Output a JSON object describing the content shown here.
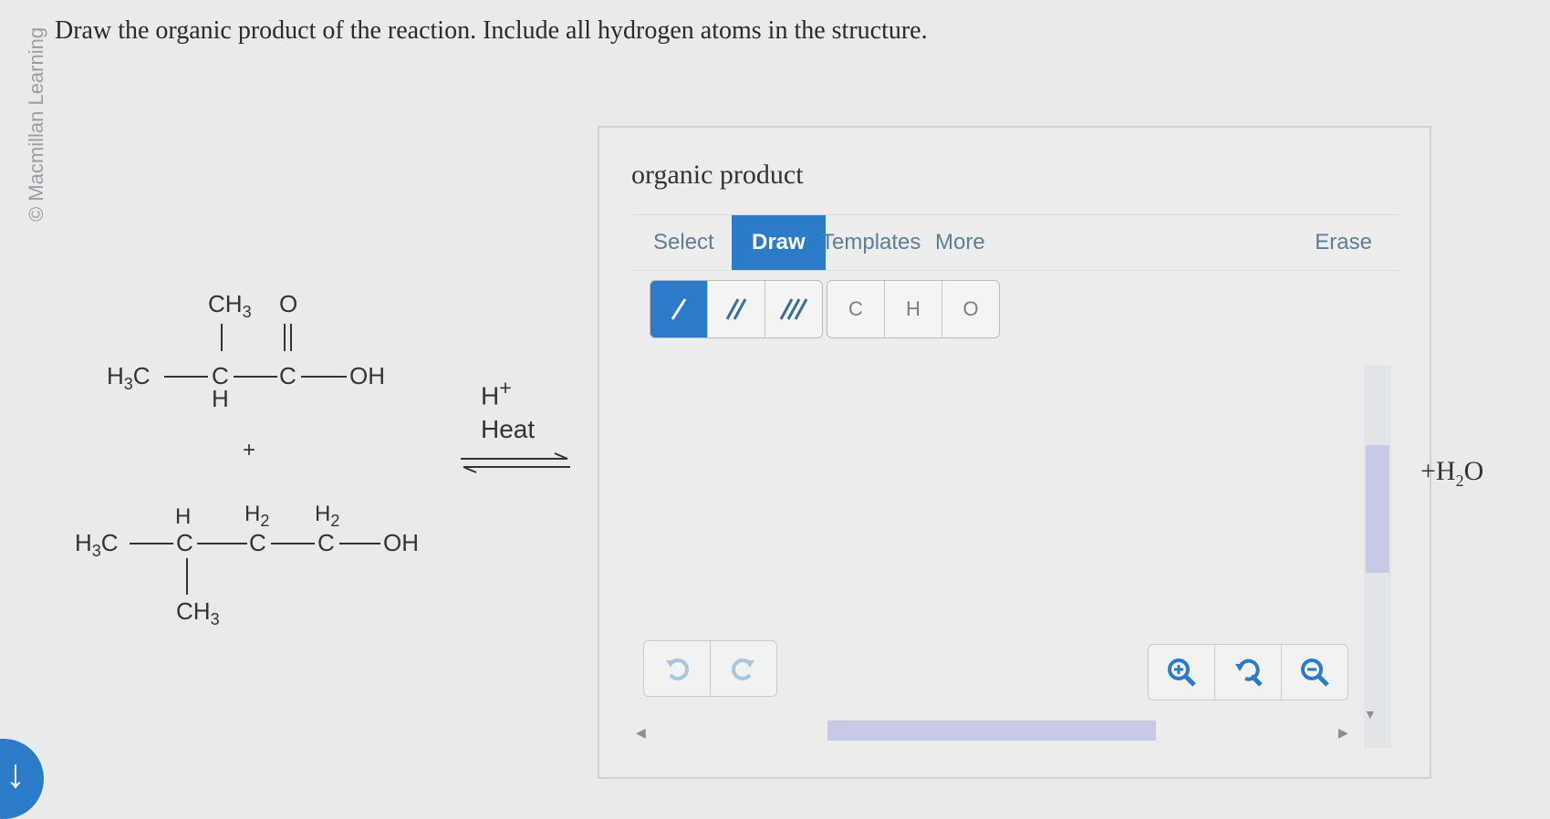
{
  "watermark": "© Macmillan Learning",
  "question": "Draw the organic product of the reaction. Include all hydrogen atoms in the structure.",
  "reactant1": {
    "h3c": "H3C",
    "ch3": "CH3",
    "o": "O",
    "c1": "C",
    "c2": "C",
    "h": "H",
    "oh": "OH"
  },
  "plus": "+",
  "reactant2": {
    "h3c": "H3C",
    "h": "H",
    "h2a": "H2",
    "h2b": "H2",
    "c1": "C",
    "c2": "C",
    "c3": "C",
    "oh": "OH",
    "ch3": "CH3"
  },
  "conditions": {
    "catalyst": "H+",
    "heat": "Heat"
  },
  "editor": {
    "title": "organic product",
    "tabs": [
      "Select",
      "Draw",
      "Templates",
      "More"
    ],
    "active_tab": "Draw",
    "erase": "Erase",
    "bond_tools": [
      "single-bond",
      "double-bond",
      "triple-bond"
    ],
    "atoms": [
      "C",
      "H",
      "O"
    ],
    "undo_icon": "undo-icon",
    "redo_icon": "redo-icon",
    "zoom_icons": [
      "zoom-in-icon",
      "zoom-reset-icon",
      "zoom-out-icon"
    ]
  },
  "side_product": "+H2O",
  "colors": {
    "accent": "#2c7bc8",
    "tab_text": "#5a7f96",
    "scroll": "#c7c9e6"
  }
}
